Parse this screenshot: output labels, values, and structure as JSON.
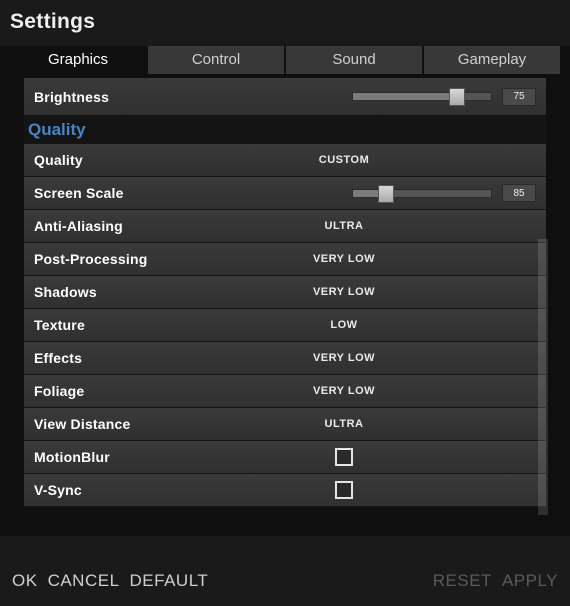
{
  "title": "Settings",
  "tabs": [
    "Graphics",
    "Control",
    "Sound",
    "Gameplay"
  ],
  "activeTab": 0,
  "section": {
    "quality": "Quality"
  },
  "rows": {
    "brightness": {
      "label": "Brightness",
      "value": 75,
      "max": 100
    },
    "quality": {
      "label": "Quality",
      "value": "CUSTOM"
    },
    "screenScale": {
      "label": "Screen Scale",
      "value": 85,
      "max": 200,
      "fillPct": 24
    },
    "aa": {
      "label": "Anti-Aliasing",
      "value": "ULTRA"
    },
    "post": {
      "label": "Post-Processing",
      "value": "VERY LOW"
    },
    "shadows": {
      "label": "Shadows",
      "value": "VERY LOW"
    },
    "texture": {
      "label": "Texture",
      "value": "LOW"
    },
    "effects": {
      "label": "Effects",
      "value": "VERY LOW"
    },
    "foliage": {
      "label": "Foliage",
      "value": "VERY LOW"
    },
    "viewDist": {
      "label": "View Distance",
      "value": "ULTRA"
    },
    "motionBlur": {
      "label": "MotionBlur",
      "checked": false
    },
    "vsync": {
      "label": "V-Sync",
      "checked": false
    }
  },
  "footer": {
    "ok": "OK",
    "cancel": "CANCEL",
    "default": "DEFAULT",
    "reset": "RESET",
    "apply": "APPLY"
  }
}
